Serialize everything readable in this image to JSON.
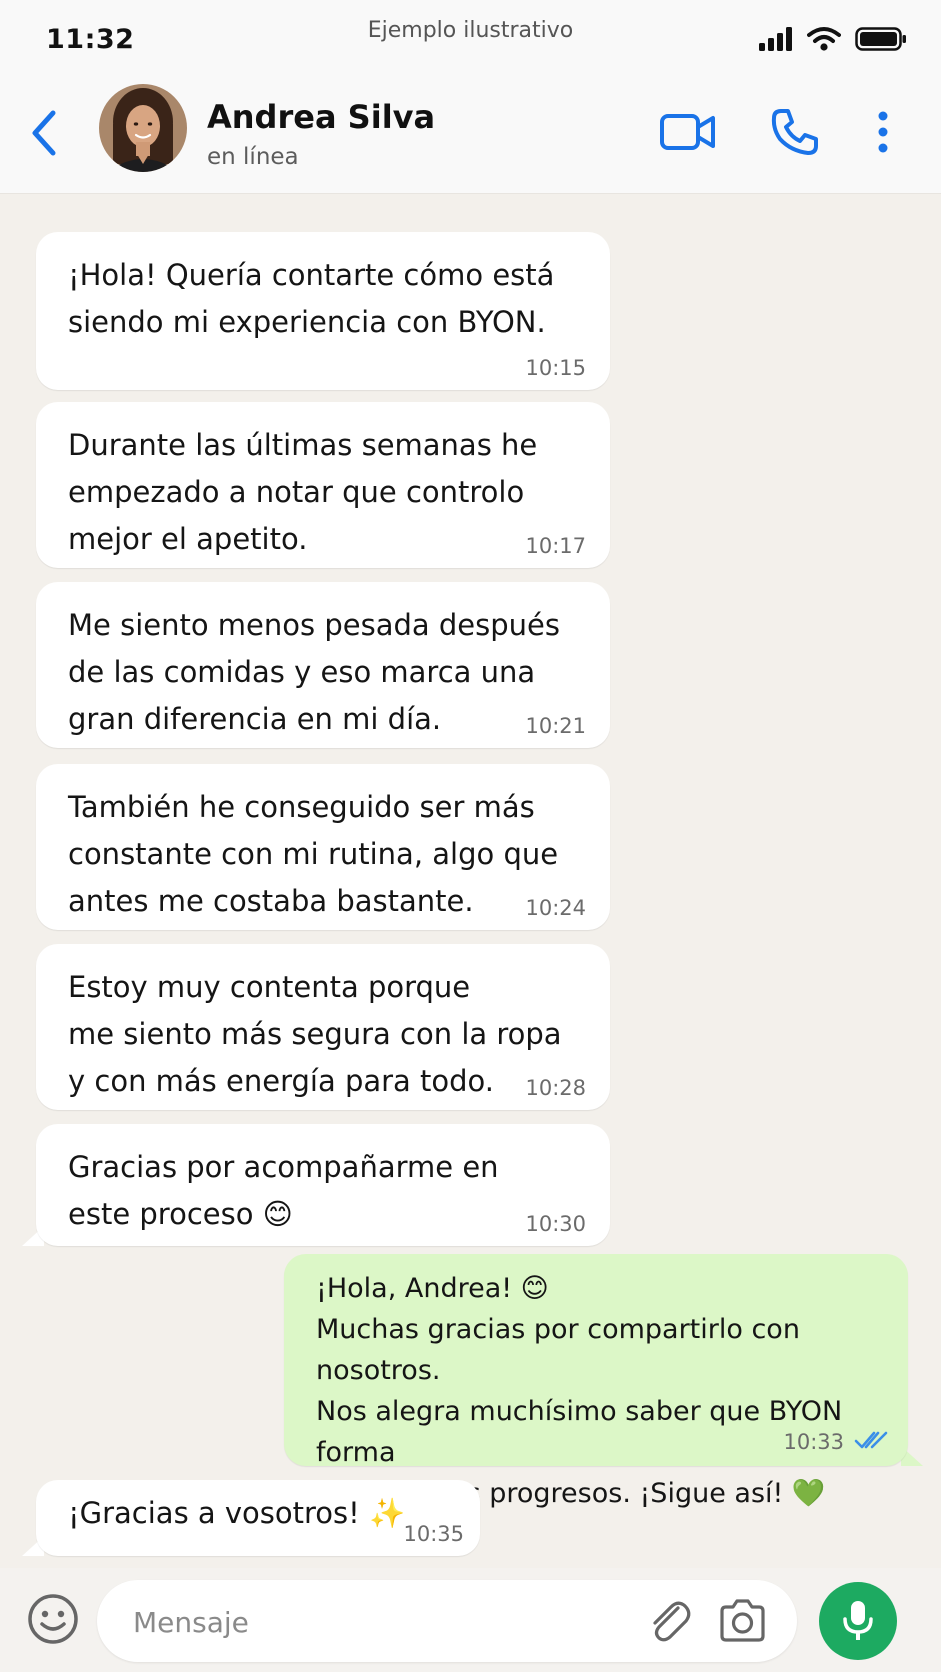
{
  "status_bar": {
    "time": "11:32",
    "center_text": "Ejemplo ilustrativo",
    "icons": [
      "signal-icon",
      "wifi-icon",
      "battery-icon"
    ]
  },
  "header": {
    "contact_name": "Andrea Silva",
    "contact_status": "en línea",
    "icons": [
      "back-icon",
      "video-call-icon",
      "phone-icon",
      "more-options-icon"
    ],
    "accent_color": "#1a73e8"
  },
  "messages": [
    {
      "direction": "in",
      "text": "¡Hola! Quería contarte cómo está\nsiendo mi experiencia con BYON.",
      "time": "10:15"
    },
    {
      "direction": "in",
      "text": "Durante las últimas semanas he\nempezado a notar que controlo\nmejor el apetito.",
      "time": "10:17"
    },
    {
      "direction": "in",
      "text": "Me siento menos pesada después\nde las comidas y eso marca una\ngran diferencia en mi día.",
      "time": "10:21"
    },
    {
      "direction": "in",
      "text": "También he conseguido ser más\nconstante con mi rutina, algo que\nantes me costaba bastante.",
      "time": "10:24"
    },
    {
      "direction": "in",
      "text": "Estoy muy contenta porque\nme siento más segura con la ropa\ny con más energía para todo.",
      "time": "10:28"
    },
    {
      "direction": "in",
      "text": "Gracias por acompañarme en\neste proceso 😊",
      "time": "10:30"
    },
    {
      "direction": "out",
      "text": "¡Hola, Andrea! 😊\nMuchas gracias por compartirlo con nosotros.\nNos alegra muchísimo saber que BYON forma\nparte de tus progresos. ¡Sigue así! 💚",
      "time": "10:33",
      "read": true
    },
    {
      "direction": "in",
      "text": "¡Gracias a vosotros! ✨",
      "time": "10:35"
    }
  ],
  "composer": {
    "placeholder": "Mensaje",
    "icons": [
      "emoji-icon",
      "attach-icon",
      "camera-icon",
      "mic-icon"
    ],
    "send_color": "#1daa61"
  },
  "colors": {
    "chat_background": "#f3f0eb",
    "incoming_bubble": "#ffffff",
    "outgoing_bubble": "#dcf7c7",
    "read_ticks": "#3b8fe8"
  }
}
